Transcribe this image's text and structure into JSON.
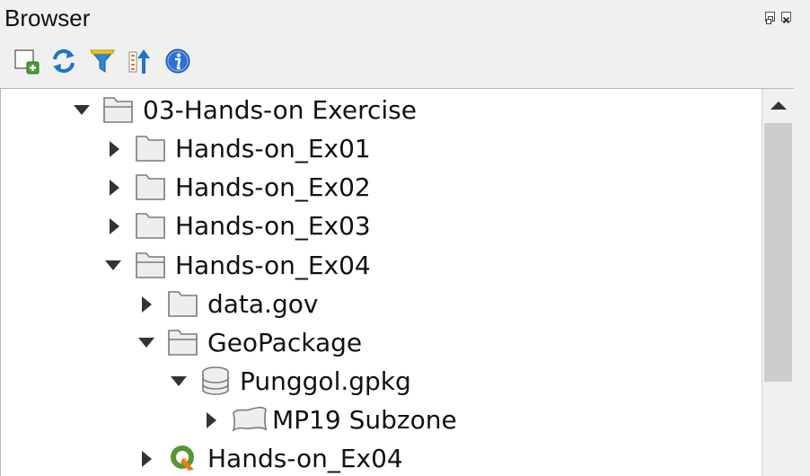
{
  "panel": {
    "title": "Browser"
  },
  "toolbar": {
    "buttons": [
      {
        "icon": "add-selected-layers-icon"
      },
      {
        "icon": "refresh-icon"
      },
      {
        "icon": "filter-icon"
      },
      {
        "icon": "collapse-all-icon"
      },
      {
        "icon": "info-icon"
      }
    ]
  },
  "tree": {
    "rows": [
      {
        "label": "03-Hands-on Exercise",
        "icon": "folder-open-icon",
        "expanded": true,
        "depth": 0
      },
      {
        "label": "Hands-on_Ex01",
        "icon": "folder-icon",
        "expanded": false,
        "depth": 1
      },
      {
        "label": "Hands-on_Ex02",
        "icon": "folder-icon",
        "expanded": false,
        "depth": 1
      },
      {
        "label": "Hands-on_Ex03",
        "icon": "folder-icon",
        "expanded": false,
        "depth": 1
      },
      {
        "label": "Hands-on_Ex04",
        "icon": "folder-open-icon",
        "expanded": true,
        "depth": 1
      },
      {
        "label": "data.gov",
        "icon": "folder-icon",
        "expanded": false,
        "depth": 2
      },
      {
        "label": "GeoPackage",
        "icon": "folder-open-icon",
        "expanded": true,
        "depth": 2
      },
      {
        "label": "Punggol.gpkg",
        "icon": "database-icon",
        "expanded": true,
        "depth": 3
      },
      {
        "label": "MP19 Subzone",
        "icon": "polygon-layer-icon",
        "expanded": false,
        "depth": 4
      },
      {
        "label": "Hands-on_Ex04",
        "icon": "qgis-project-icon",
        "expanded": false,
        "depth": 2
      }
    ]
  },
  "colors": {
    "folder_fill": "#eeeeee",
    "folder_stroke": "#7a7a7a",
    "refresh_blue": "#1e73c8",
    "filter_blue": "#2f86d6",
    "filter_yellow": "#f3c613",
    "info_blue": "#2e6fd1",
    "qgis_green": "#589632",
    "qgis_yellow": "#ee7913"
  }
}
